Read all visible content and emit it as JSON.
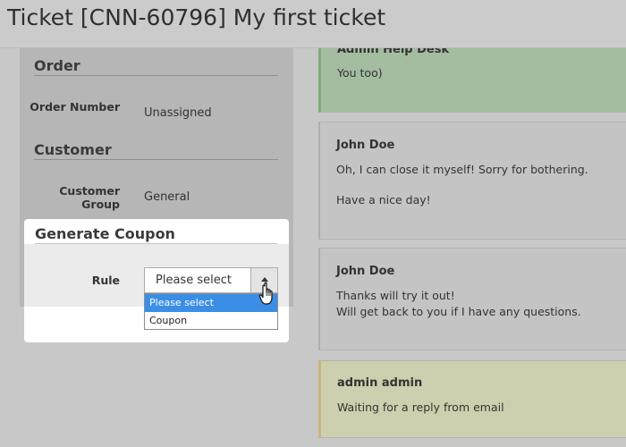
{
  "header": {
    "title": "Ticket [CNN-60796] My first ticket"
  },
  "sidebar": {
    "order": {
      "heading": "Order",
      "number_label": "Order Number",
      "number_value": "Unassigned"
    },
    "customer": {
      "heading": "Customer",
      "group_label": "Customer Group",
      "group_value": "General"
    },
    "coupon": {
      "heading": "Generate Coupon",
      "rule_label": "Rule",
      "rule_value": "Please select",
      "options": [
        "Please select",
        "Coupon"
      ],
      "selected_index": 0
    }
  },
  "messages": [
    {
      "author": "Admin Help Desk",
      "lines": [
        "You too)"
      ],
      "kind": "admin"
    },
    {
      "author": "John Doe",
      "lines": [
        "Oh, I can close it myself! Sorry for bothering.",
        "Have a nice day!"
      ],
      "kind": "user"
    },
    {
      "author": "John Doe",
      "lines": [
        "Thanks will try it out!",
        "Will get back to you if I have any questions."
      ],
      "kind": "user"
    },
    {
      "author": "admin admin",
      "lines": [
        "Waiting for a reply from email"
      ],
      "kind": "waiting"
    }
  ],
  "icons": {
    "cursor": "hand-pointer-icon",
    "arrow": "caret-up-icon"
  },
  "colors": {
    "highlight": "#3a8ee6",
    "admin_bg": "#a4bda0",
    "user_bg": "#c4c4c4",
    "waiting_bg": "#cdcfae"
  }
}
